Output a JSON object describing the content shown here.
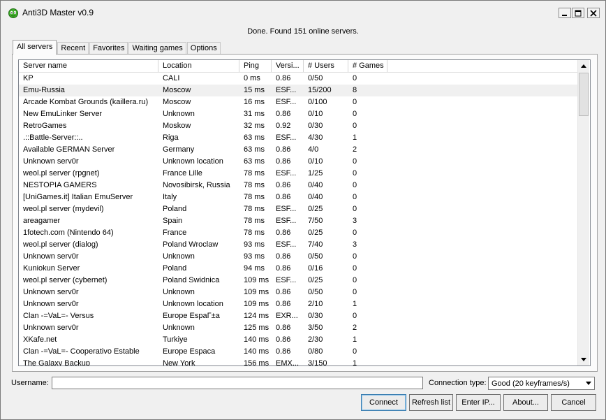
{
  "window": {
    "title": "Anti3D Master v0.9",
    "icon": "green-alien-app-icon",
    "controls": [
      "minimize-icon",
      "maximize-icon",
      "close-icon"
    ]
  },
  "status_text": "Done. Found 151 online servers.",
  "tabs": [
    {
      "label": "All servers",
      "active": true
    },
    {
      "label": "Recent",
      "active": false
    },
    {
      "label": "Favorites",
      "active": false
    },
    {
      "label": "Waiting games",
      "active": false
    },
    {
      "label": "Options",
      "active": false
    }
  ],
  "table": {
    "columns": [
      "Server name",
      "Location",
      "Ping",
      "Versi...",
      "# Users",
      "# Games"
    ],
    "selected_row": 1,
    "rows": [
      [
        "KP",
        "CALI",
        "0 ms",
        "0.86",
        "0/50",
        "0"
      ],
      [
        "Emu-Russia",
        "Moscow",
        "15 ms",
        "ESF...",
        "15/200",
        "8"
      ],
      [
        "Arcade Kombat Grounds (kaillera.ru)",
        "Moscow",
        "16 ms",
        "ESF...",
        "0/100",
        "0"
      ],
      [
        "New EmuLinker Server",
        "Unknown",
        "31 ms",
        "0.86",
        "0/10",
        "0"
      ],
      [
        "RetroGames",
        "Moskow",
        "32 ms",
        "0.92",
        "0/30",
        "0"
      ],
      [
        ".::Battle-Server::..",
        "Riga",
        "63 ms",
        "ESF...",
        "4/30",
        "1"
      ],
      [
        "Available GERMAN Server",
        "Germany",
        "63 ms",
        "0.86",
        "4/0",
        "2"
      ],
      [
        "Unknown serv0r",
        "Unknown location",
        "63 ms",
        "0.86",
        "0/10",
        "0"
      ],
      [
        "weol.pl server (rpgnet)",
        "France Lille",
        "78 ms",
        "ESF...",
        "1/25",
        "0"
      ],
      [
        "NESTOPIA GAMERS",
        "Novosibirsk, Russia",
        "78 ms",
        "0.86",
        "0/40",
        "0"
      ],
      [
        "[UniGames.it] Italian EmuServer",
        "Italy",
        "78 ms",
        "0.86",
        "0/40",
        "0"
      ],
      [
        "weol.pl server (mydevil)",
        "Poland",
        "78 ms",
        "ESF...",
        "0/25",
        "0"
      ],
      [
        "areagamer",
        "Spain",
        "78 ms",
        "ESF...",
        "7/50",
        "3"
      ],
      [
        "1fotech.com (Nintendo 64)",
        "France",
        "78 ms",
        "0.86",
        "0/25",
        "0"
      ],
      [
        "weol.pl server (dialog)",
        "Poland Wroclaw",
        "93 ms",
        "ESF...",
        "7/40",
        "3"
      ],
      [
        "Unknown serv0r",
        "Unknown",
        "93 ms",
        "0.86",
        "0/50",
        "0"
      ],
      [
        "Kuniokun Server",
        "Poland",
        "94 ms",
        "0.86",
        "0/16",
        "0"
      ],
      [
        "weol.pl server (cybernet)",
        "Poland Swidnica",
        "109 ms",
        "ESF...",
        "0/25",
        "0"
      ],
      [
        "Unknown serv0r",
        "Unknown",
        "109 ms",
        "0.86",
        "0/50",
        "0"
      ],
      [
        "Unknown serv0r",
        "Unknown location",
        "109 ms",
        "0.86",
        "2/10",
        "1"
      ],
      [
        "Clan -=VaL=- Versus",
        "Europe EspaΓ±a",
        "124 ms",
        "EXR...",
        "0/30",
        "0"
      ],
      [
        "Unknown serv0r",
        "Unknown",
        "125 ms",
        "0.86",
        "3/50",
        "2"
      ],
      [
        "XKafe.net",
        "Turkiye",
        "140 ms",
        "0.86",
        "2/30",
        "1"
      ],
      [
        "Clan -=VaL=- Cooperativo Estable",
        "Europe Espaca",
        "140 ms",
        "0.86",
        "0/80",
        "0"
      ],
      [
        "The Galaxy Backup",
        "New York",
        "156 ms",
        "EMX...",
        "3/150",
        "1"
      ]
    ]
  },
  "username": {
    "label": "Username:",
    "value": ""
  },
  "connection": {
    "label": "Connection type:",
    "selected": "Good (20 keyframes/s)"
  },
  "buttons": {
    "connect": "Connect",
    "refresh": "Refresh list",
    "enter_ip": "Enter IP...",
    "about": "About...",
    "cancel": "Cancel"
  }
}
